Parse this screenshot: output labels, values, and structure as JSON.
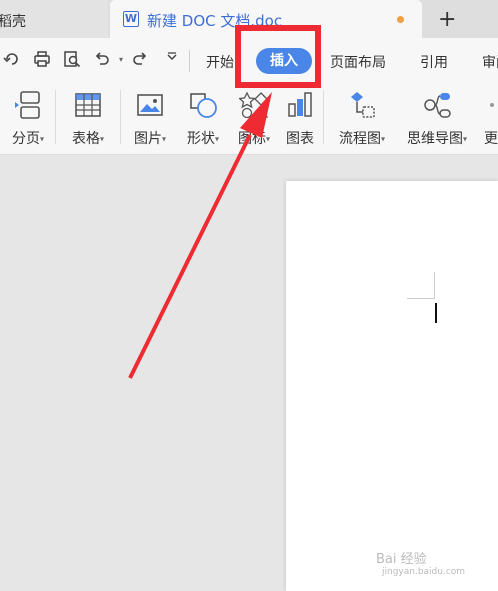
{
  "tabs": {
    "prev_label": "稻壳",
    "active_title": "新建 DOC 文档.doc",
    "new_tab": "+"
  },
  "menu": {
    "items": [
      "开始",
      "插入",
      "页面布局",
      "引用",
      "审阅"
    ],
    "active": "插入"
  },
  "ribbon": {
    "page_break": "分页",
    "table": "表格",
    "picture": "图片",
    "shape": "形状",
    "icon": "图标",
    "chart": "图表",
    "flowchart": "流程图",
    "mindmap": "思维导图",
    "more": "更"
  },
  "watermark": {
    "main": "Bai 经验",
    "url": "jingyan.baidu.com"
  },
  "colors": {
    "accent": "#4a86e8",
    "highlight": "#ee2b32",
    "modified_dot": "#f0a040"
  }
}
